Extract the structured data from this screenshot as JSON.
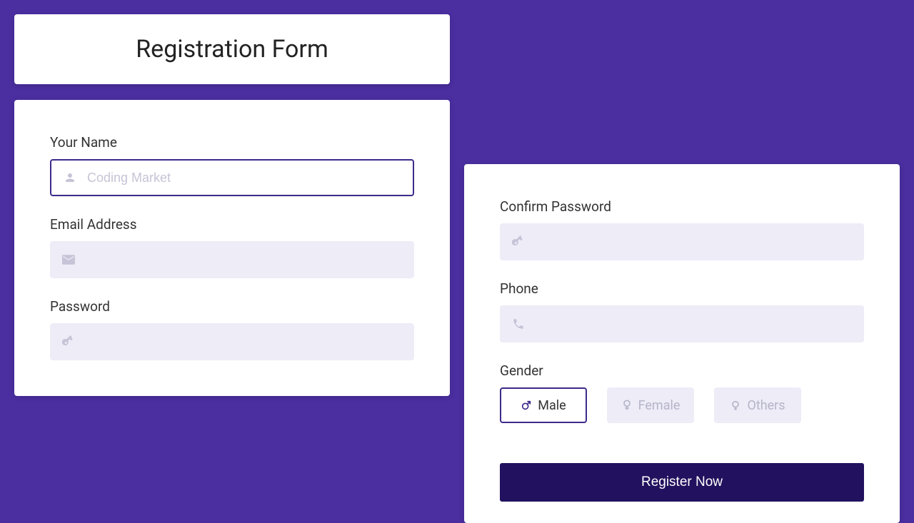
{
  "title": "Registration Form",
  "left": {
    "name": {
      "label": "Your Name",
      "placeholder": "Coding Market",
      "value": ""
    },
    "email": {
      "label": "Email Address",
      "placeholder": "",
      "value": ""
    },
    "password": {
      "label": "Password",
      "placeholder": "",
      "value": ""
    }
  },
  "right": {
    "confirm": {
      "label": "Confirm Password",
      "placeholder": "",
      "value": ""
    },
    "phone": {
      "label": "Phone",
      "placeholder": "",
      "value": ""
    },
    "gender": {
      "label": "Gender",
      "options": [
        "Male",
        "Female",
        "Others"
      ],
      "selected": "Male"
    },
    "submit": "Register Now"
  },
  "colors": {
    "page_bg": "#4b2ea0",
    "accent": "#3d2a8a",
    "input_bg": "#edecf7",
    "button_bg": "#22115e"
  }
}
